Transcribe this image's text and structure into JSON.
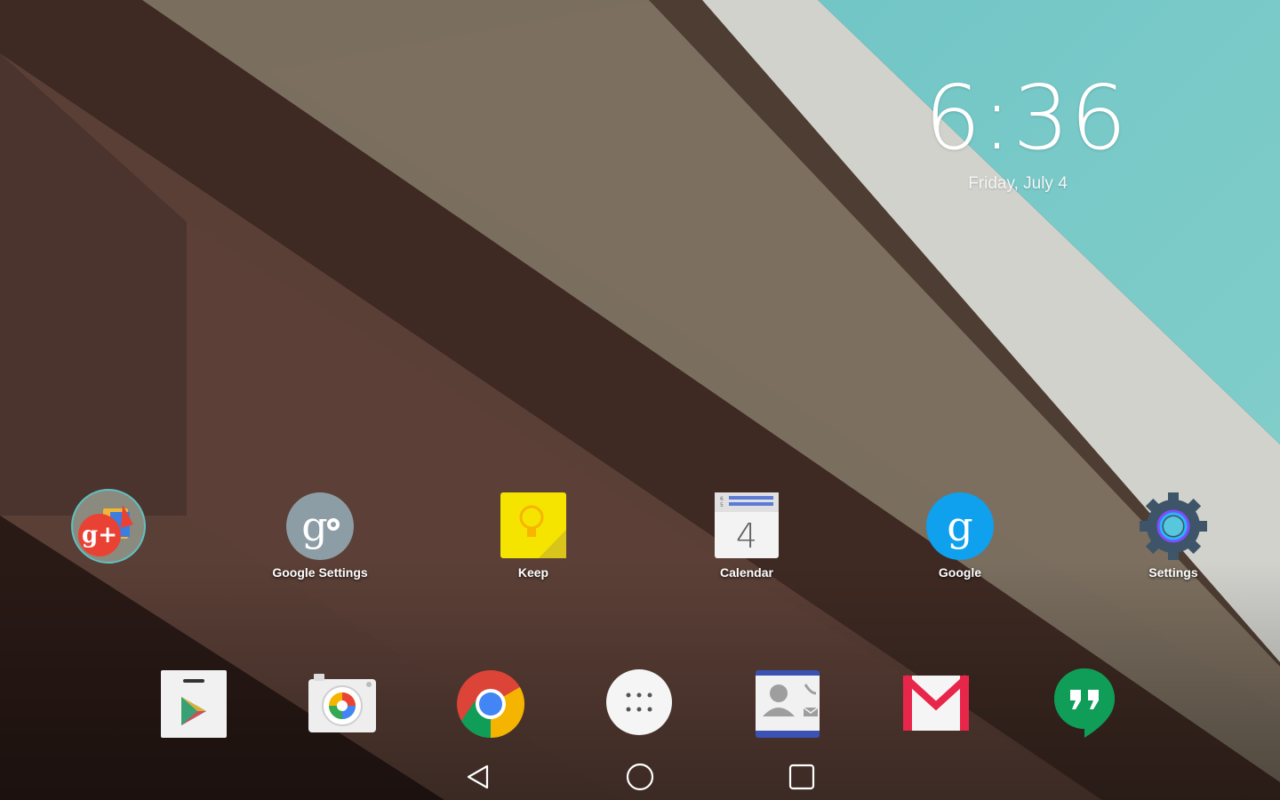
{
  "clock": {
    "time": "6:36",
    "date": "Friday, July 4"
  },
  "home_apps": [
    {
      "name": "google-plus-folder",
      "label": ""
    },
    {
      "name": "google-settings",
      "label": "Google Settings"
    },
    {
      "name": "keep",
      "label": "Keep"
    },
    {
      "name": "calendar",
      "label": "Calendar",
      "day": "4"
    },
    {
      "name": "google",
      "label": "Google"
    },
    {
      "name": "settings",
      "label": "Settings"
    }
  ],
  "dock": [
    "play-store-icon",
    "camera-icon",
    "chrome-icon",
    "app-drawer-icon",
    "contacts-icon",
    "gmail-icon",
    "hangouts-icon"
  ],
  "nav": [
    "back",
    "home",
    "recents"
  ],
  "colors": {
    "teal_sky": "#76c8c8",
    "accent_blue": "#2196f3",
    "keep_yellow": "#f4e200",
    "gmail_red": "#db4437",
    "hangouts_green": "#0f9d58"
  }
}
